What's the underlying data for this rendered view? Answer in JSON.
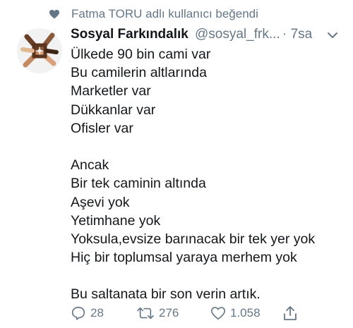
{
  "liked_by": {
    "text": "Fatma TORU adlı kullanıcı beğendi"
  },
  "tweet": {
    "display_name": "Sosyal Farkındalık",
    "handle": "@sosyal_frk...",
    "time": "· 7sa",
    "lines": [
      "Ülkede 90 bin cami var",
      "Bu camilerin altlarında",
      "Marketler var",
      "Dükkanlar var",
      "Ofisler var",
      "",
      "Ancak",
      "Bir tek caminin altında",
      "Aşevi yok",
      "Yetimhane yok",
      "Yoksula,evsize barınacak bir tek yer yok",
      "Hiç bir toplumsal yaraya merhem yok",
      "",
      "Bu saltanata bir son verin artık."
    ]
  },
  "actions": {
    "reply_count": "28",
    "retweet_count": "276",
    "like_count": "1.058"
  },
  "icons": {
    "like_heart": "heart-icon",
    "caret": "chevron-down-icon",
    "reply": "reply-icon",
    "retweet": "retweet-icon",
    "like": "heart-outline-icon",
    "share": "share-icon"
  },
  "colors": {
    "secondary_text": "#657786",
    "primary_text": "#14171a"
  }
}
